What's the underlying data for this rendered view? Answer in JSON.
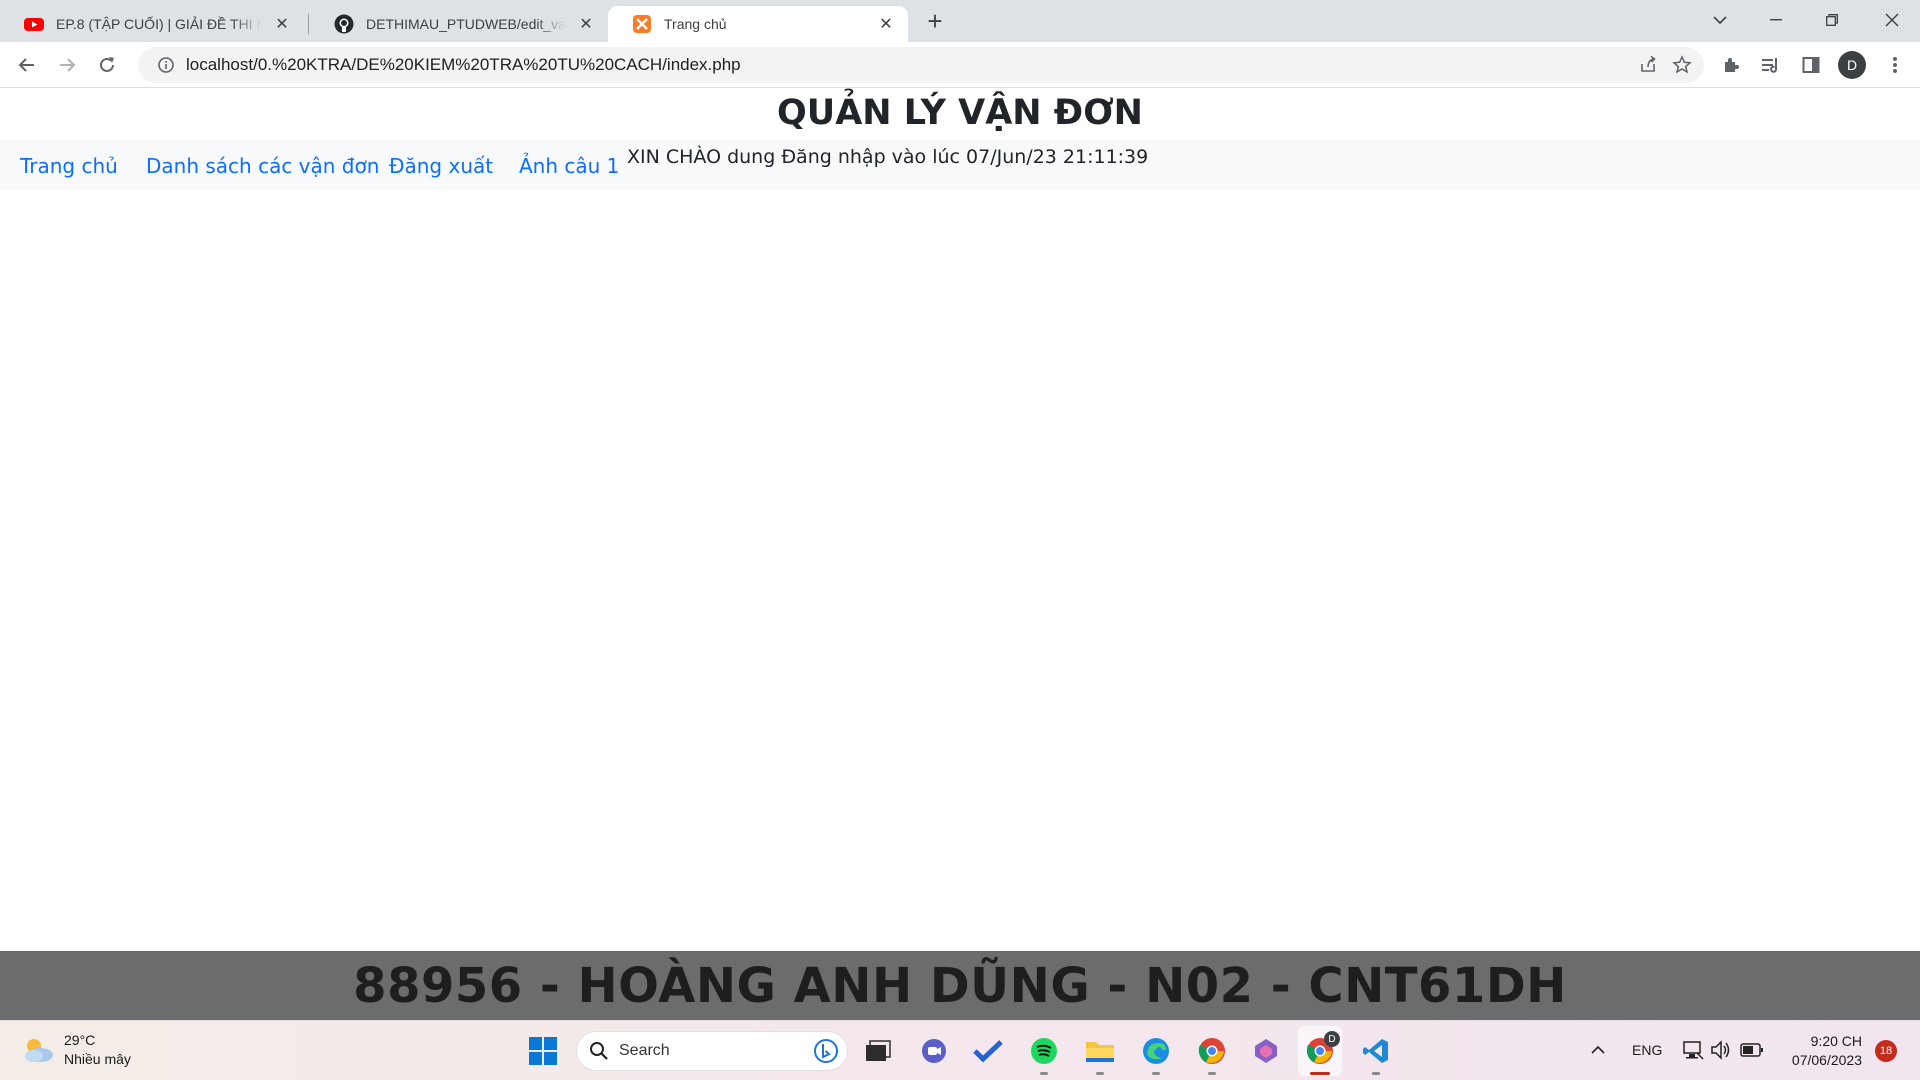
{
  "browser": {
    "tabs": [
      {
        "title": "EP.8 (TẬP CUỐI) | GIẢI ĐỀ THI MẪU",
        "icon": "youtube-icon"
      },
      {
        "title": "DETHIMAU_PTUDWEB/edit_vandon",
        "icon": "github-icon"
      },
      {
        "title": "Trang chủ",
        "icon": "xampp-icon",
        "active": true
      }
    ],
    "url": "localhost/0.%20KTRA/DE%20KIEM%20TRA%20TU%20CACH/index.php",
    "profile_initial": "D"
  },
  "page": {
    "title": "QUẢN LÝ VẬN ĐƠN",
    "nav": [
      {
        "label": "Trang chủ"
      },
      {
        "label": "Danh sách các vận đơn"
      },
      {
        "label": "Đăng xuất"
      },
      {
        "label": "Ảnh câu 1"
      }
    ],
    "greeting": "XIN CHÀO dung Đăng nhập vào lúc 07/Jun/23 21:11:39",
    "footer": "88956 - HOÀNG ANH DŨNG - N02 - CNT61DH",
    "link_color": "#0d6efd",
    "footer_bg": "#6c6c6c"
  },
  "taskbar": {
    "weather_temp": "29°C",
    "weather_desc": "Nhiều mây",
    "search_placeholder": "Search",
    "language": "ENG",
    "time": "9:20 CH",
    "date": "07/06/2023",
    "notification_count": "18",
    "chrome_badge": "D"
  }
}
